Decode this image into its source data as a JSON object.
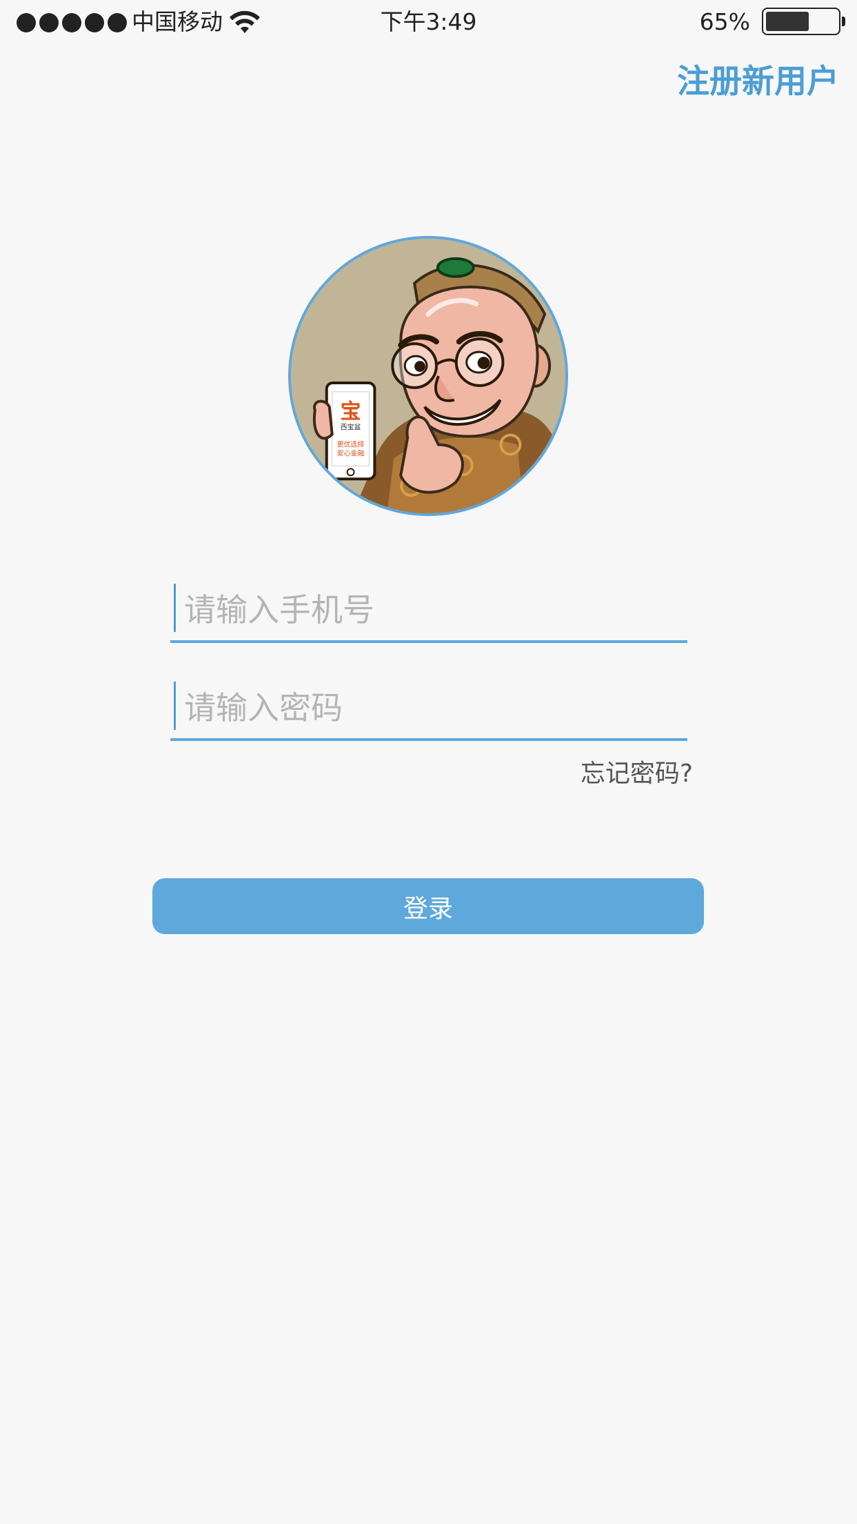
{
  "status_bar": {
    "signal_dots": 5,
    "carrier": "中国移动",
    "time": "下午3:49",
    "battery_percent": "65%",
    "battery_level": 0.65,
    "icons": [
      "signal-dots-icon",
      "wifi-icon",
      "battery-icon"
    ]
  },
  "header": {
    "register_label": "注册新用户"
  },
  "avatar": {
    "phone_logo_char": "宝",
    "phone_brand": "西宝盆",
    "phone_slogan_line1": "更优选择",
    "phone_slogan_line2": "安心金融"
  },
  "form": {
    "phone_placeholder": "请输入手机号",
    "phone_value": "",
    "password_placeholder": "请输入密码",
    "password_value": "",
    "forgot_label": "忘记密码?",
    "login_label": "登录"
  },
  "colors": {
    "accent": "#5ea8dc",
    "link": "#4a9ed4",
    "background": "#f7f7f8",
    "placeholder": "#b4b4b4"
  }
}
